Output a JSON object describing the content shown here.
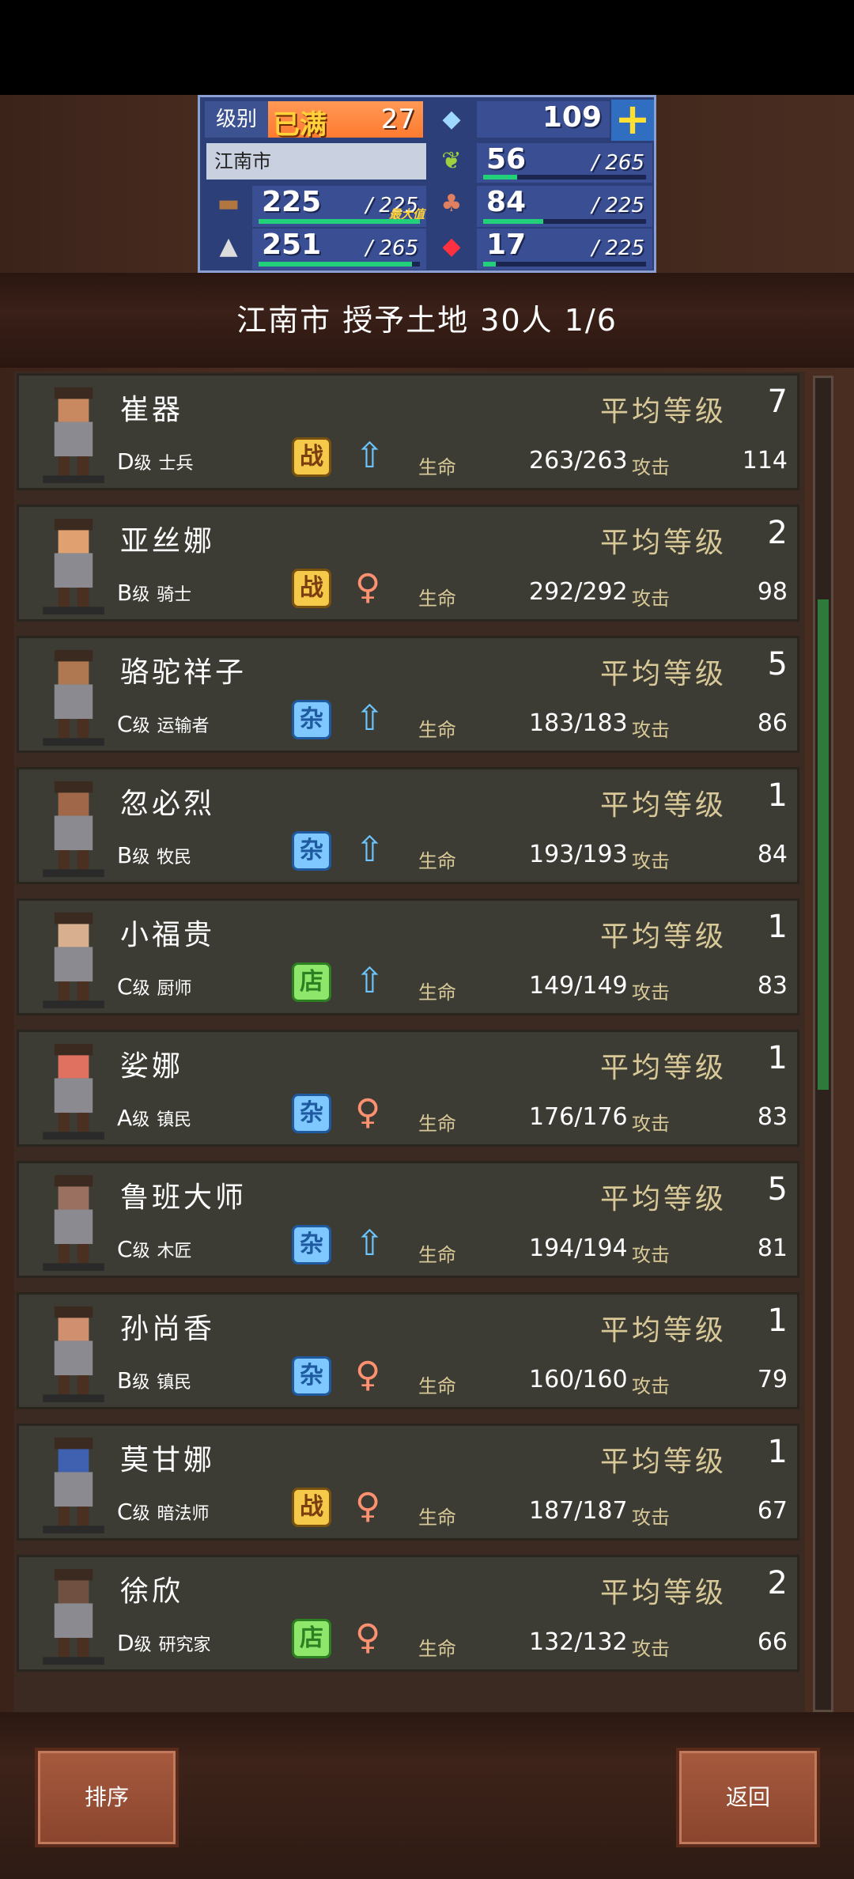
{
  "status": {
    "level_label": "级别",
    "level_max": "已满",
    "level_value": "27",
    "gems": "109",
    "city": "江南市",
    "wood": {
      "value": "225",
      "max": "225",
      "max_tag": "最大值",
      "fill": 1.0
    },
    "ore": {
      "value": "251",
      "max": "265",
      "fill": 0.95
    },
    "grass": {
      "value": "56",
      "max": "265",
      "fill": 0.21
    },
    "food": {
      "value": "84",
      "max": "225",
      "fill": 0.37
    },
    "ruby": {
      "value": "17",
      "max": "225",
      "fill": 0.08
    },
    "sep": "/"
  },
  "title": "江南市 授予土地 30人 1/6",
  "labels": {
    "avg": "平均等级",
    "hp": "生命",
    "atk": "攻击"
  },
  "rows": [
    {
      "name": "崔器",
      "avg": "7",
      "grade": "D",
      "grade_suffix": "级",
      "job": "士兵",
      "badge": "战",
      "badge_type": "zhan",
      "gender": "m",
      "hp": "263/263",
      "atk": "114"
    },
    {
      "name": "亚丝娜",
      "avg": "2",
      "grade": "B",
      "grade_suffix": "级",
      "job": "骑士",
      "badge": "战",
      "badge_type": "zhan",
      "gender": "f",
      "hp": "292/292",
      "atk": "98"
    },
    {
      "name": "骆驼祥子",
      "avg": "5",
      "grade": "C",
      "grade_suffix": "级",
      "job": "运输者",
      "badge": "杂",
      "badge_type": "za",
      "gender": "m",
      "hp": "183/183",
      "atk": "86"
    },
    {
      "name": "忽必烈",
      "avg": "1",
      "grade": "B",
      "grade_suffix": "级",
      "job": "牧民",
      "badge": "杂",
      "badge_type": "za",
      "gender": "m",
      "hp": "193/193",
      "atk": "84"
    },
    {
      "name": "小福贵",
      "avg": "1",
      "grade": "C",
      "grade_suffix": "级",
      "job": "厨师",
      "badge": "店",
      "badge_type": "dian",
      "gender": "m",
      "hp": "149/149",
      "atk": "83"
    },
    {
      "name": "娑娜",
      "avg": "1",
      "grade": "A",
      "grade_suffix": "级",
      "job": "镇民",
      "badge": "杂",
      "badge_type": "za",
      "gender": "f",
      "hp": "176/176",
      "atk": "83"
    },
    {
      "name": "鲁班大师",
      "avg": "5",
      "grade": "C",
      "grade_suffix": "级",
      "job": "木匠",
      "badge": "杂",
      "badge_type": "za",
      "gender": "m",
      "hp": "194/194",
      "atk": "81"
    },
    {
      "name": "孙尚香",
      "avg": "1",
      "grade": "B",
      "grade_suffix": "级",
      "job": "镇民",
      "badge": "杂",
      "badge_type": "za",
      "gender": "f",
      "hp": "160/160",
      "atk": "79"
    },
    {
      "name": "莫甘娜",
      "avg": "1",
      "grade": "C",
      "grade_suffix": "级",
      "job": "暗法师",
      "badge": "战",
      "badge_type": "zhan",
      "gender": "f",
      "hp": "187/187",
      "atk": "67"
    },
    {
      "name": "徐欣",
      "avg": "2",
      "grade": "D",
      "grade_suffix": "级",
      "job": "研究家",
      "badge": "店",
      "badge_type": "dian",
      "gender": "f",
      "hp": "132/132",
      "atk": "66"
    }
  ],
  "buttons": {
    "sort": "排序",
    "back": "返回"
  }
}
